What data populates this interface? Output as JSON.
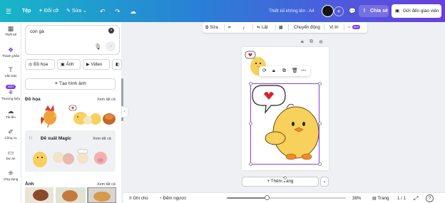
{
  "topbar": {
    "home_label": "Tệp",
    "resize_label": "Đổi cỡ",
    "edit_label": "Sửa",
    "doc_title": "Thiết kế không tên - A4",
    "share_label": "Chia sẻ",
    "send_label": "Gửi đến giáo viên",
    "brand_color": "#2a7fd6"
  },
  "rail": {
    "items": [
      {
        "label": "Thiết kế",
        "icon": "layout-icon"
      },
      {
        "label": "Thành phần",
        "icon": "shapes-icon"
      },
      {
        "label": "Văn bản",
        "icon": "text-icon"
      },
      {
        "label": "Thương hiệu",
        "icon": "brand-icon"
      },
      {
        "label": "Tải lên",
        "icon": "upload-icon"
      },
      {
        "label": "Công cụ",
        "icon": "tools-icon"
      },
      {
        "label": "Dự án",
        "icon": "folder-icon"
      },
      {
        "label": "Ứng dụng",
        "icon": "apps-icon"
      }
    ],
    "new_badge": "MỚI"
  },
  "panel": {
    "search_value": "con gà",
    "chips": [
      "Đồ họa",
      "Ảnh",
      "Video"
    ],
    "generate_label": "Tạo hình ảnh",
    "graphics_title": "Đồ họa",
    "magic_title": "Đề xuất Magic",
    "photos_title": "Ảnh",
    "see_all": "Xem tất cả"
  },
  "context_toolbar": {
    "edit": "Sửa",
    "flip": "Lật",
    "animate": "Chuyển động",
    "position": "Vị trí",
    "new_tag": "Mới"
  },
  "canvas": {
    "add_page": "+ Thêm trang"
  },
  "footer": {
    "notes": "Ghi chú",
    "timer": "Đếm ngược",
    "zoom_percent": 38,
    "zoom": "38%",
    "pages_label": "Trang",
    "page_count": "1 / 1"
  }
}
